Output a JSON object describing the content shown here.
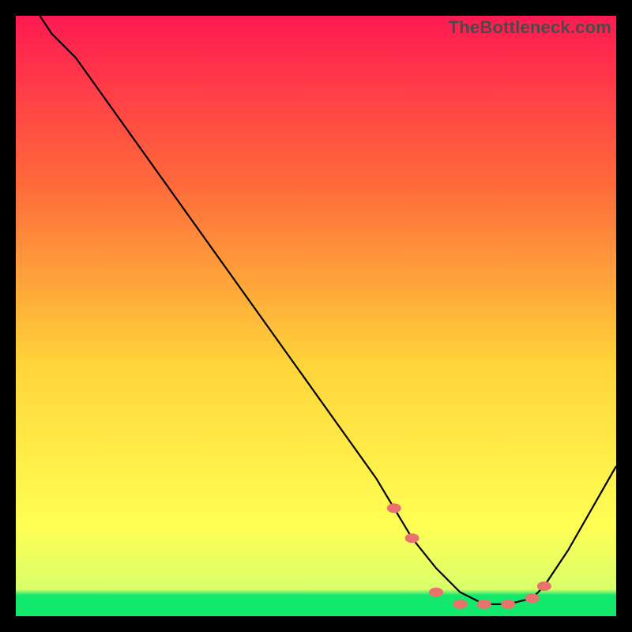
{
  "watermark": "TheBottleneck.com",
  "colors": {
    "gradient_top": "#ff1a52",
    "gradient_mid1": "#ff6a3a",
    "gradient_mid2": "#ffd43a",
    "gradient_mid3": "#ffff55",
    "gradient_bottom_band": "#12e86b",
    "curve": "#000000",
    "marker": "#e9736c",
    "background": "#000000"
  },
  "chart_data": {
    "type": "line",
    "title": "",
    "xlabel": "",
    "ylabel": "",
    "xlim": [
      0,
      100
    ],
    "ylim": [
      0,
      100
    ],
    "series": [
      {
        "name": "bottleneck-curve",
        "x": [
          4,
          6,
          10,
          20,
          30,
          40,
          50,
          60,
          63,
          66,
          70,
          74,
          78,
          82,
          86,
          88,
          92,
          100
        ],
        "y": [
          100,
          97,
          93,
          79,
          65,
          51,
          37,
          23,
          18,
          13,
          8,
          4,
          2,
          2,
          3,
          5,
          11,
          25
        ]
      }
    ],
    "markers": {
      "name": "highlight-points",
      "x": [
        63,
        66,
        70,
        74,
        78,
        82,
        86,
        88
      ],
      "y": [
        18,
        13,
        4,
        2,
        2,
        2,
        3,
        5
      ]
    },
    "background_gradient_stops": [
      {
        "offset": 0.0,
        "color": "#ff1a52"
      },
      {
        "offset": 0.28,
        "color": "#ff6a3a"
      },
      {
        "offset": 0.58,
        "color": "#ffd43a"
      },
      {
        "offset": 0.85,
        "color": "#ffff55"
      },
      {
        "offset": 0.955,
        "color": "#d9ff6a"
      },
      {
        "offset": 0.965,
        "color": "#12e86b"
      },
      {
        "offset": 1.0,
        "color": "#12e86b"
      }
    ]
  }
}
